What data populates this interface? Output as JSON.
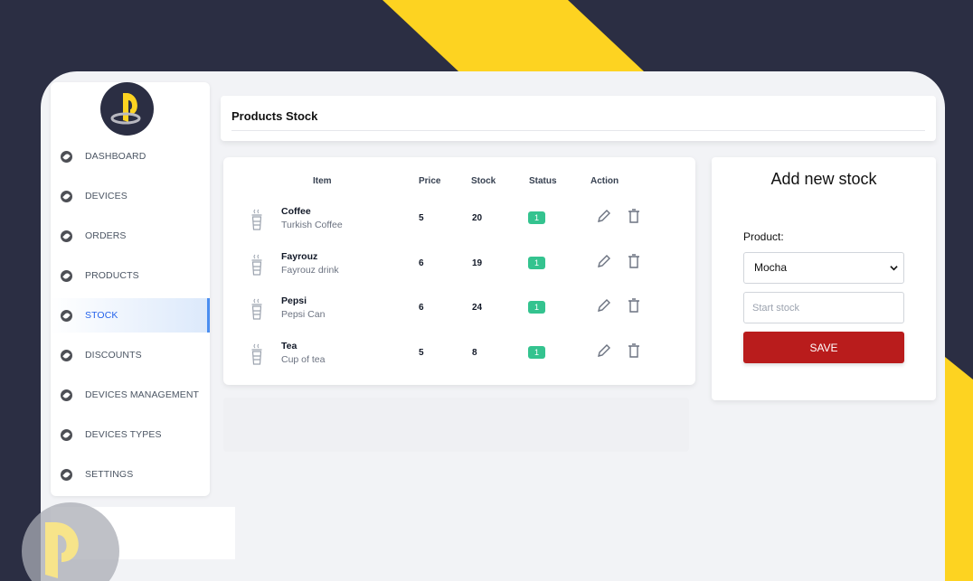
{
  "brand": {
    "logo_icon": "playstation-style-logo",
    "accent": "#fdd321"
  },
  "sidebar": {
    "items": [
      {
        "label": "DASHBOARD",
        "icon": "compass-icon",
        "active": false
      },
      {
        "label": "DEVICES",
        "icon": "compass-icon",
        "active": false
      },
      {
        "label": "ORDERS",
        "icon": "compass-icon",
        "active": false
      },
      {
        "label": "PRODUCTS",
        "icon": "compass-icon",
        "active": false
      },
      {
        "label": "STOCK",
        "icon": "compass-icon",
        "active": true
      },
      {
        "label": "DISCOUNTS",
        "icon": "compass-icon",
        "active": false
      },
      {
        "label": "DEVICES MANAGEMENT",
        "icon": "compass-icon",
        "active": false
      },
      {
        "label": "DEVICES TYPES",
        "icon": "compass-icon",
        "active": false
      },
      {
        "label": "SETTINGS",
        "icon": "compass-icon",
        "active": false
      }
    ]
  },
  "header": {
    "title": "Products Stock"
  },
  "table": {
    "columns": [
      "Item",
      "Price",
      "Stock",
      "Status",
      "Action"
    ],
    "rows": [
      {
        "name": "Coffee",
        "desc": "Turkish Coffee",
        "price": "5",
        "stock": "20",
        "status": "1"
      },
      {
        "name": "Fayrouz",
        "desc": "Fayrouz drink",
        "price": "6",
        "stock": "19",
        "status": "1"
      },
      {
        "name": "Pepsi",
        "desc": "Pepsi Can",
        "price": "6",
        "stock": "24",
        "status": "1"
      },
      {
        "name": "Tea",
        "desc": "Cup of tea",
        "price": "5",
        "stock": "8",
        "status": "1"
      }
    ],
    "status_color": "#34c38f"
  },
  "add_stock": {
    "title": "Add new stock",
    "product_label": "Product:",
    "product_selected": "Mocha",
    "stock_placeholder": "Start stock",
    "save_label": "SAVE",
    "save_color": "#b91c1c"
  }
}
